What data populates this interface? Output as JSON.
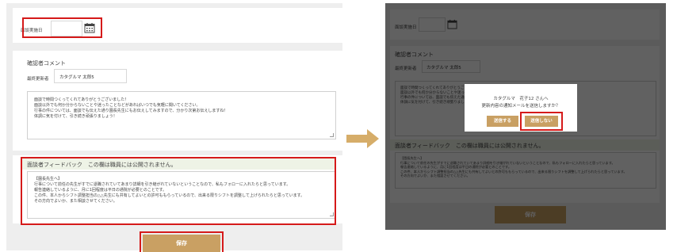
{
  "form": {
    "interview_date_label": "面談実施日",
    "confirmer_section_title": "確認者コメント",
    "last_updater_label": "最終更新者",
    "last_updater_value": "カタグルマ 太郎5",
    "comment_lines": [
      "面談で時間つくってくれてありがとうございました！",
      "面談以外でも何か分からないことや迷ったことなどがあればいつでも気軽に聞いてください。",
      "行事の件については、面談でも伝えた通り園長先生にもお伝えしてみますので、分かり次第お伝えしますね！",
      "体調に気を付けて、引き続き頑張りましょう！"
    ],
    "feedback_title": "面談者フィードバック　この欄は職員には公開されません。",
    "feedback_lines": [
      "【園長先生へ】",
      "行事について前任の先生がすでに退職されていてあまり詳細を引き継がれていないということなので、私もフォローに入れたらと思っています。",
      "報告連絡しているように、月に1回程度は平日の通院が必要とのことです。",
      "この件、本人からシフト調整担当の△△先生にも共有してよいとの許可ももらっているので、出来る限りシフトを調整して上げられたらと思っています。",
      "その方向でよいか、また相談させてください。"
    ],
    "save_label": "保存"
  },
  "modal": {
    "recipient": "カタグルマ　花子12 さんへ",
    "question": "更新内容の通知メールを送信しますか？",
    "send_label": "送信する",
    "no_send_label": "送信しない"
  },
  "colors": {
    "accent": "#c9a063",
    "highlight": "#d51a1a",
    "arrow": "#d6ad69",
    "feedback_header_bg": "#eef3e6"
  }
}
